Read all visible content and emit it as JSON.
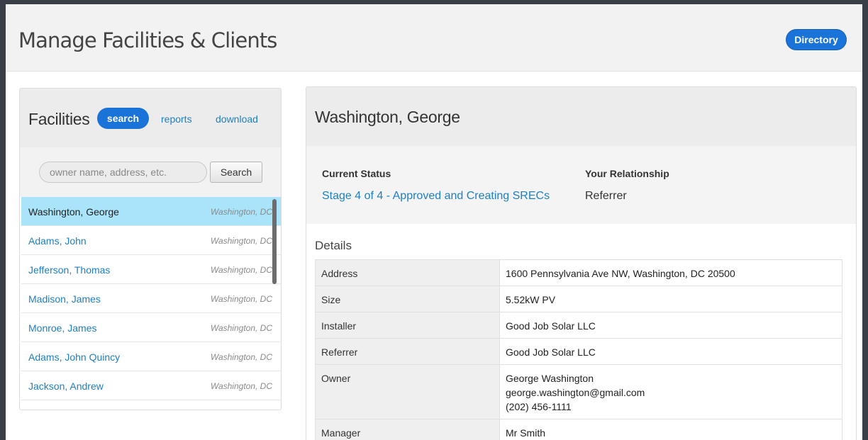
{
  "header": {
    "title": "Manage Facilities & Clients",
    "directory_label": "Directory"
  },
  "facilities": {
    "title": "Facilities",
    "tabs": {
      "search": "search",
      "reports": "reports",
      "download": "download"
    },
    "search_placeholder": "owner name, address, etc.",
    "search_button": "Search",
    "items": [
      {
        "name": "Washington, George",
        "city": "Washington, DC",
        "selected": true
      },
      {
        "name": "Adams, John",
        "city": "Washington, DC"
      },
      {
        "name": "Jefferson, Thomas",
        "city": "Washington, DC"
      },
      {
        "name": "Madison, James",
        "city": "Washington, DC"
      },
      {
        "name": "Monroe, James",
        "city": "Washington, DC"
      },
      {
        "name": "Adams, John Quincy",
        "city": "Washington, DC"
      },
      {
        "name": "Jackson, Andrew",
        "city": "Washington, DC"
      }
    ]
  },
  "detail": {
    "name": "Washington, George",
    "status_label": "Current Status",
    "status_value": "Stage 4 of 4 - Approved and Creating SRECs",
    "relationship_label": "Your Relationship",
    "relationship_value": "Referrer",
    "details_heading": "Details",
    "rows": [
      {
        "key": "Address",
        "value": "1600 Pennsylvania Ave NW, Washington, DC 20500"
      },
      {
        "key": "Size",
        "value": "5.52kW PV"
      },
      {
        "key": "Installer",
        "value": "Good Job Solar LLC"
      },
      {
        "key": "Referrer",
        "value": "Good Job Solar LLC"
      },
      {
        "key": "Owner",
        "value_lines": [
          "George Washington",
          "george.washington@gmail.com",
          "(202) 456-1111"
        ]
      },
      {
        "key": "Manager",
        "value": "Mr Smith"
      }
    ]
  },
  "colors": {
    "accent": "#1a73d9",
    "link": "#1f7fc1",
    "selected_row": "#a9e4fb"
  }
}
